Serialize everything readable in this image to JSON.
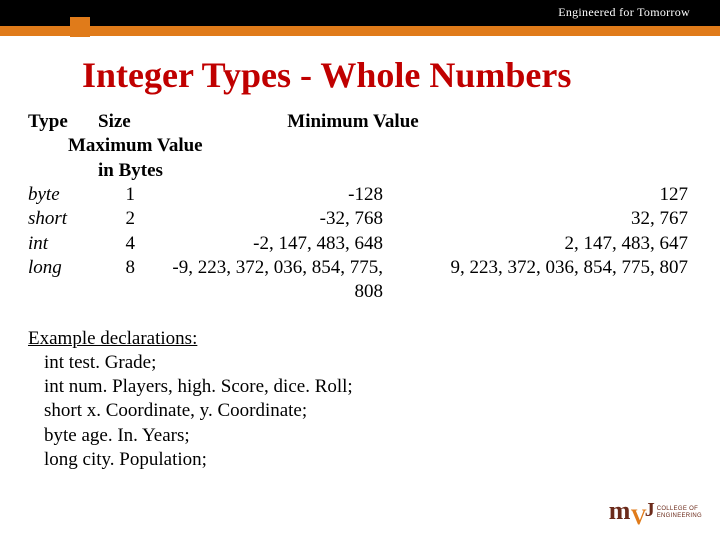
{
  "header": {
    "tagline": "Engineered for Tomorrow"
  },
  "title": "Integer Types - Whole Numbers",
  "table": {
    "headers": {
      "type": "Type",
      "size": "Size",
      "min": "Minimum Value",
      "max_line1": "Maximum Value",
      "size_sub": "in Bytes"
    },
    "rows": [
      {
        "type": "byte",
        "size": "1",
        "min": "-128",
        "max": "127"
      },
      {
        "type": "short",
        "size": "2",
        "min": "-32, 768",
        "max": "32, 767"
      },
      {
        "type": "int",
        "size": "4",
        "min": "-2, 147, 483, 648",
        "max": "2, 147, 483, 647"
      },
      {
        "type": "long",
        "size": "8",
        "min": "-9, 223, 372, 036, 854, 775, 808",
        "max": "9, 223, 372, 036, 854, 775, 807"
      }
    ]
  },
  "examples": {
    "title": "Example declarations:",
    "lines": [
      "int test. Grade;",
      "int num. Players, high. Score, dice. Roll;",
      "short  x. Coordinate, y. Coordinate;",
      "byte age. In. Years;",
      "long city. Population;"
    ]
  },
  "logo": {
    "line1": "COLLEGE OF",
    "line2": "ENGINEERING"
  }
}
